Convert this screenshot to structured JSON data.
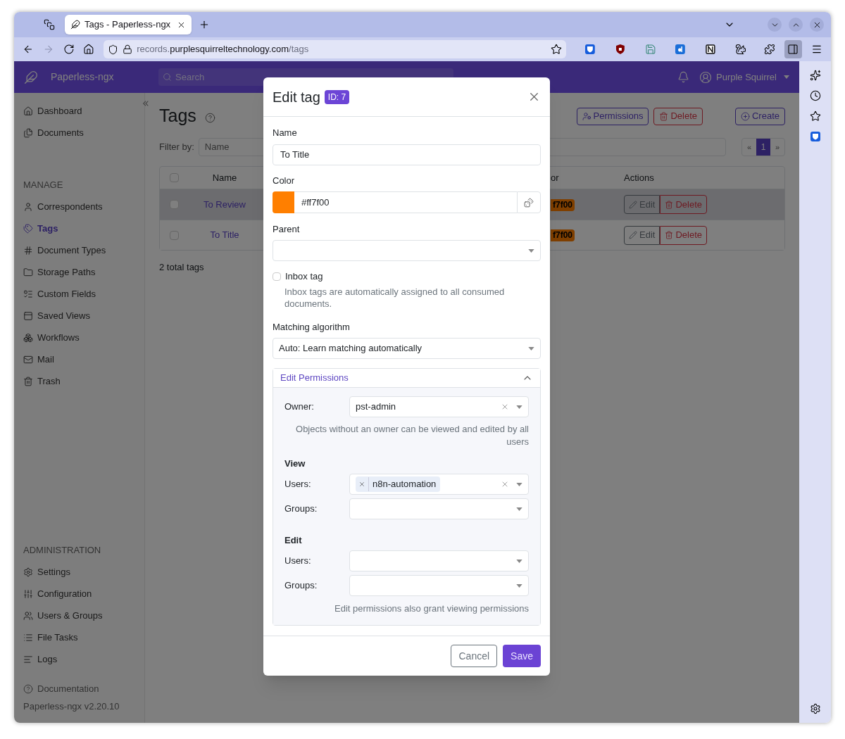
{
  "browser": {
    "tab_title": "Tags - Paperless-ngx",
    "url_subdomain": "records.",
    "url_domain": "purplesquirreltechnology.com",
    "url_path": "/tags",
    "forward_enabled": false,
    "sidebar_open": true
  },
  "header": {
    "brand": "Paperless-ngx",
    "search_placeholder": "Search",
    "user": "Purple Squirrel"
  },
  "sidebar": {
    "groups": [
      {
        "items": [
          {
            "label": "Dashboard",
            "selected": false
          },
          {
            "label": "Documents",
            "selected": false
          }
        ]
      },
      {
        "heading": "MANAGE",
        "items": [
          {
            "label": "Correspondents",
            "selected": false
          },
          {
            "label": "Tags",
            "selected": true
          },
          {
            "label": "Document Types",
            "selected": false
          },
          {
            "label": "Storage Paths",
            "selected": false
          },
          {
            "label": "Custom Fields",
            "selected": false
          },
          {
            "label": "Saved Views",
            "selected": false
          },
          {
            "label": "Workflows",
            "selected": false
          },
          {
            "label": "Mail",
            "selected": false
          },
          {
            "label": "Trash",
            "selected": false
          }
        ]
      },
      {
        "heading": "ADMINISTRATION",
        "items": [
          {
            "label": "Settings",
            "selected": false
          },
          {
            "label": "Configuration",
            "selected": false
          },
          {
            "label": "Users & Groups",
            "selected": false
          },
          {
            "label": "File Tasks",
            "selected": false
          },
          {
            "label": "Logs",
            "selected": false
          }
        ]
      }
    ],
    "documentation": "Documentation",
    "version": "Paperless-ngx v2.20.10"
  },
  "page": {
    "title": "Tags",
    "buttons": [
      {
        "label": "Permissions",
        "kind": "permissions"
      },
      {
        "label": "Delete",
        "kind": "delete"
      },
      {
        "label": "Create",
        "kind": "create"
      }
    ],
    "filter_label": "Filter by:",
    "filter_placeholder": "Name",
    "pagination": [
      {
        "label": "«",
        "selected": false
      },
      {
        "label": "1",
        "selected": true
      },
      {
        "label": "»",
        "selected": false
      }
    ],
    "table": {
      "columns": [
        "Name",
        "or",
        "Actions"
      ],
      "all_checked": false,
      "rows": [
        {
          "name": "To Review",
          "checked": false,
          "color_text": "f7f00",
          "highlighted": true,
          "actions": [
            "Edit",
            "Delete"
          ]
        },
        {
          "name": "To Title",
          "checked": false,
          "color_text": "f7f00",
          "highlighted": false,
          "actions": [
            "Edit",
            "Delete"
          ]
        }
      ]
    },
    "total": "2 total tags"
  },
  "modal": {
    "title": "Edit tag",
    "id_badge": "ID: 7",
    "name": {
      "label": "Name",
      "value": "To Title"
    },
    "color": {
      "label": "Color",
      "value": "#ff7f00",
      "color": "#ff7f00"
    },
    "parent": {
      "label": "Parent"
    },
    "inbox": {
      "label": "Inbox tag",
      "checked": false,
      "hint": "Inbox tags are automatically assigned to all consumed documents."
    },
    "matching": {
      "label": "Matching algorithm",
      "value": "Auto: Learn matching automatically"
    },
    "permissions": {
      "title": "Edit Permissions",
      "expanded": true,
      "owner": {
        "label": "Owner:",
        "value": "pst-admin"
      },
      "owner_hint": "Objects without an owner can be viewed and edited by all users",
      "sections": [
        {
          "heading": "View",
          "fields": [
            {
              "label": "Users:",
              "chips": [
                "n8n-automation"
              ]
            },
            {
              "label": "Groups:"
            }
          ]
        },
        {
          "heading": "Edit",
          "fields": [
            {
              "label": "Users:"
            },
            {
              "label": "Groups:"
            }
          ]
        }
      ],
      "hint": "Edit permissions also grant viewing permissions"
    },
    "buttons": [
      {
        "label": "Cancel",
        "kind": "secondary"
      },
      {
        "label": "Save",
        "kind": "primary"
      }
    ]
  }
}
